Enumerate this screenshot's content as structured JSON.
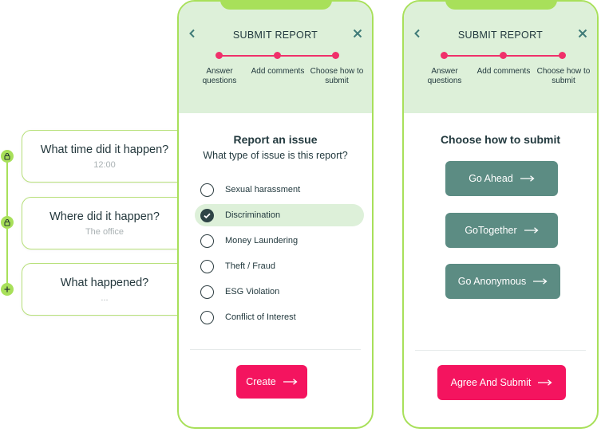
{
  "timeline": {
    "cards": [
      {
        "question": "What time did it happen?",
        "answer": "12:00",
        "icon": "lock-icon"
      },
      {
        "question": "Where did it happen?",
        "answer": "The office",
        "icon": "lock-icon"
      },
      {
        "question": "What happened?",
        "answer": "...",
        "icon": "plus-icon"
      }
    ],
    "accent": "#a8e05a"
  },
  "phone1": {
    "title": "SUBMIT REPORT",
    "steps": [
      {
        "label": "Answer questions"
      },
      {
        "label": "Add comments"
      },
      {
        "label": "Choose how to submit"
      }
    ],
    "heading": "Report an issue",
    "subheading": "What type of issue is this report?",
    "options": [
      {
        "label": "Sexual harassment",
        "checked": false
      },
      {
        "label": "Discrimination",
        "checked": true
      },
      {
        "label": "Money Laundering",
        "checked": false
      },
      {
        "label": "Theft / Fraud",
        "checked": false
      },
      {
        "label": "ESG Violation",
        "checked": false
      },
      {
        "label": "Conflict of Interest",
        "checked": false
      }
    ],
    "create_label": "Create"
  },
  "phone2": {
    "title": "SUBMIT REPORT",
    "steps": [
      {
        "label": "Answer questions"
      },
      {
        "label": "Add comments"
      },
      {
        "label": "Choose how to submit"
      }
    ],
    "heading": "Choose how to submit",
    "choices": [
      {
        "label": "Go Ahead"
      },
      {
        "label": "GoTogether"
      },
      {
        "label": "Go Anonymous"
      }
    ],
    "submit_label": "Agree And Submit"
  },
  "colors": {
    "brand_green": "#a8e05a",
    "header_bg": "#ddf0d9",
    "pink": "#f4145f",
    "teal": "#5c8c83"
  }
}
